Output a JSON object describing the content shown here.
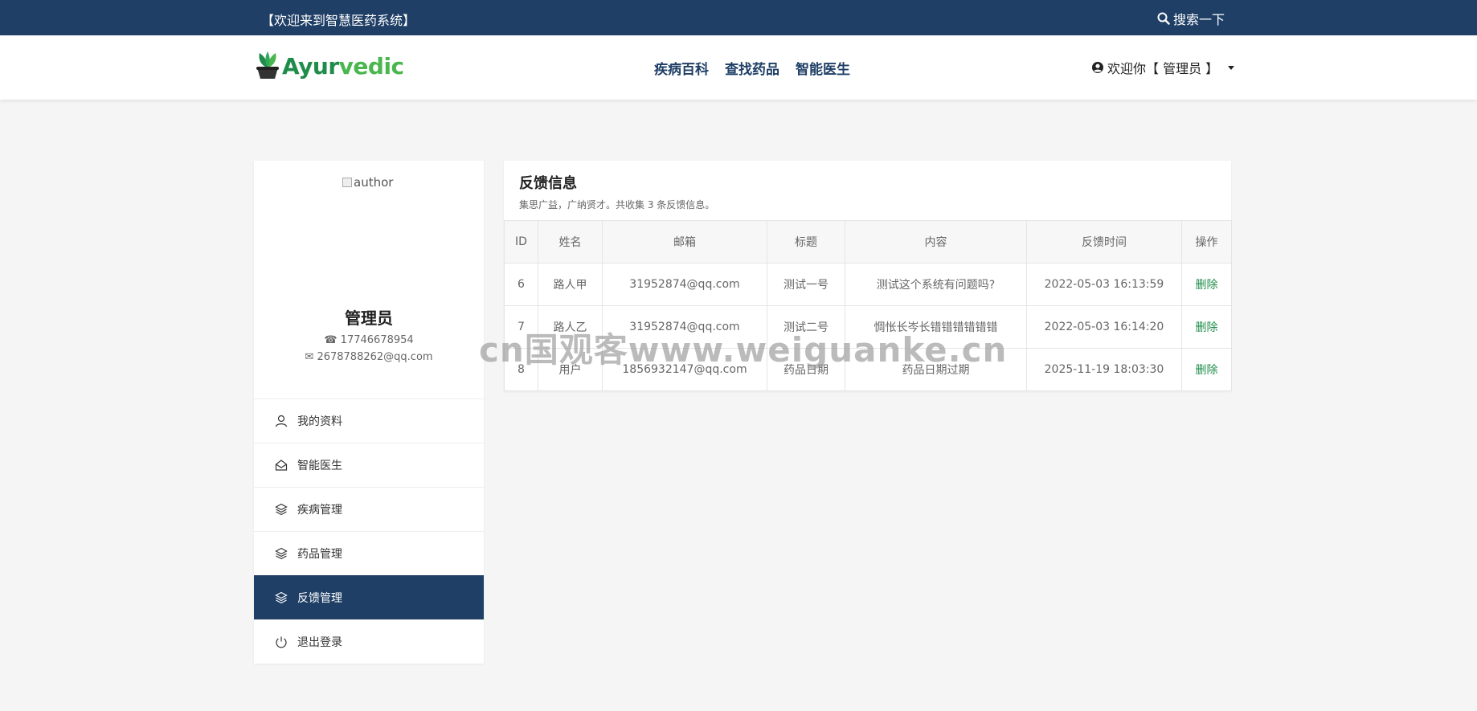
{
  "topbar": {
    "welcome": "【欢迎来到智慧医药系统】",
    "search_label": "搜索一下"
  },
  "navbar": {
    "logo_part1": "Ayur",
    "logo_part2": "vedic",
    "links": [
      "疾病百科",
      "查找药品",
      "智能医生"
    ],
    "user_label": "欢迎你【 管理员 】"
  },
  "profile": {
    "avatar_alt": "author",
    "name": "管理员",
    "phone": "17746678954",
    "email": "2678788262@qq.com"
  },
  "menu": [
    {
      "label": "我的资料",
      "icon": "user-icon",
      "active": false
    },
    {
      "label": "智能医生",
      "icon": "envelope-open-icon",
      "active": false
    },
    {
      "label": "疾病管理",
      "icon": "layers-icon",
      "active": false
    },
    {
      "label": "药品管理",
      "icon": "layers-icon",
      "active": false
    },
    {
      "label": "反馈管理",
      "icon": "layers-icon",
      "active": true
    },
    {
      "label": "退出登录",
      "icon": "power-icon",
      "active": false
    }
  ],
  "panel": {
    "title": "反馈信息",
    "subtitle": "集思广益，广纳贤才。共收集 3 条反馈信息。",
    "columns": [
      "ID",
      "姓名",
      "邮箱",
      "标题",
      "内容",
      "反馈时间",
      "操作"
    ],
    "rows": [
      [
        "6",
        "路人甲",
        "31952874@qq.com",
        "测试一号",
        "测试这个系统有问题吗?",
        "2022-05-03 16:13:59",
        "删除"
      ],
      [
        "7",
        "路人乙",
        "31952874@qq.com",
        "测试二号",
        "惆怅长岑长错错错错错错",
        "2022-05-03 16:14:20",
        "删除"
      ],
      [
        "8",
        "用户",
        "1856932147@qq.com",
        "药品日期",
        "药品日期过期",
        "2025-11-19 18:03:30",
        "删除"
      ]
    ]
  },
  "watermark": "cn国观客www.weiguanke.cn",
  "colors": {
    "primary": "#1f3f66",
    "accent_green": "#1f8c4a",
    "background": "#f5f5f5"
  }
}
